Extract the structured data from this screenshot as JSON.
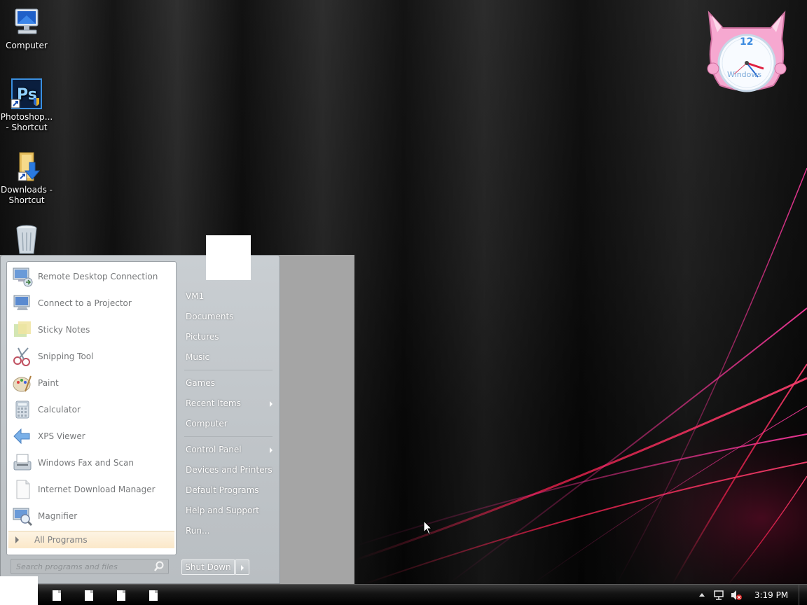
{
  "desktop": {
    "icons": [
      {
        "label": "Computer",
        "icon": "computer-icon"
      },
      {
        "label": "Photoshop... - Shortcut",
        "icon": "photoshop-icon"
      },
      {
        "label": "Downloads - Shortcut",
        "icon": "downloads-folder-icon"
      },
      {
        "label": "",
        "icon": "recycle-bin-icon"
      }
    ]
  },
  "clock_gadget": {
    "number": "12",
    "brand": "Windows",
    "icon": "clock-gadget-icon"
  },
  "start_menu": {
    "programs": [
      {
        "label": "Remote Desktop Connection",
        "icon": "remote-desktop-icon"
      },
      {
        "label": "Connect to a Projector",
        "icon": "projector-icon"
      },
      {
        "label": "Sticky Notes",
        "icon": "sticky-notes-icon"
      },
      {
        "label": "Snipping Tool",
        "icon": "snipping-tool-icon"
      },
      {
        "label": "Paint",
        "icon": "paint-icon"
      },
      {
        "label": "Calculator",
        "icon": "calculator-icon"
      },
      {
        "label": "XPS Viewer",
        "icon": "xps-viewer-icon"
      },
      {
        "label": "Windows Fax and Scan",
        "icon": "fax-scan-icon"
      },
      {
        "label": "Internet Download Manager",
        "icon": "idm-icon"
      },
      {
        "label": "Magnifier",
        "icon": "magnifier-icon"
      }
    ],
    "all_programs": "All Programs",
    "search_placeholder": "Search programs and files",
    "right_items": [
      {
        "label": "VM1"
      },
      {
        "label": "Documents"
      },
      {
        "label": "Pictures"
      },
      {
        "label": "Music"
      },
      {
        "label": "Games"
      },
      {
        "label": "Recent Items",
        "submenu": true
      },
      {
        "label": "Computer"
      },
      {
        "label": "Control Panel",
        "submenu": true
      },
      {
        "label": "Devices and Printers"
      },
      {
        "label": "Default Programs"
      },
      {
        "label": "Help and Support"
      },
      {
        "label": "Run..."
      }
    ],
    "shutdown_label": "Shut Down"
  },
  "taskbar": {
    "time": "3:19 PM",
    "tray_icons": [
      "show-hidden-icons-icon",
      "network-icon",
      "volume-muted-icon"
    ]
  },
  "colors": {
    "accent": "#fbe8c9",
    "menu_bg": "#c4c9cd"
  }
}
